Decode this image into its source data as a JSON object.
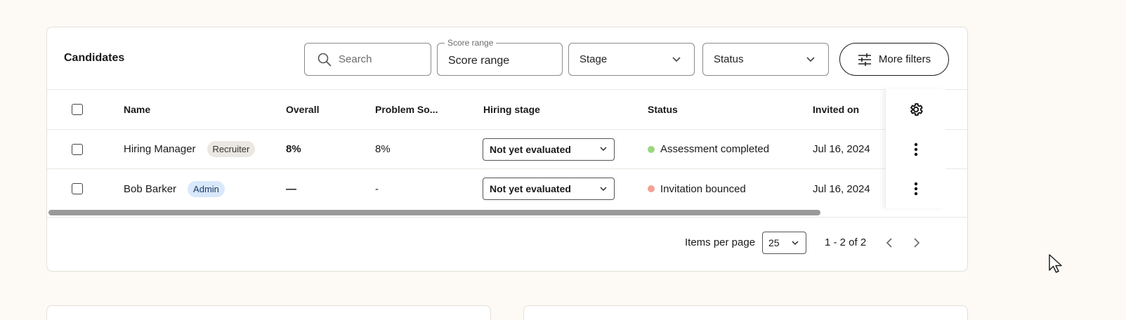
{
  "card": {
    "title": "Candidates",
    "search_placeholder": "Search",
    "score_range_legend": "Score range",
    "score_range_value": "Score range",
    "stage_label": "Stage",
    "status_label": "Status",
    "more_filters_label": "More filters"
  },
  "table": {
    "columns": [
      "Name",
      "Overall",
      "Problem So...",
      "Hiring stage",
      "Status",
      "Invited on"
    ],
    "rows": [
      {
        "name": "Hiring Manager",
        "role_tag": "Recruiter",
        "overall": "8%",
        "problem_solving": "8%",
        "hiring_stage": "Not yet evaluated",
        "status": "Assessment completed",
        "status_color": "#9bd77e",
        "invited_on": "Jul 16, 2024"
      },
      {
        "name": "Bob Barker",
        "role_tag": "Admin",
        "overall": "—",
        "problem_solving": "-",
        "hiring_stage": "Not yet evaluated",
        "status": "Invitation bounced",
        "status_color": "#f2a293",
        "invited_on": "Jul 16, 2024"
      }
    ]
  },
  "pager": {
    "items_per_page_label": "Items per page",
    "items_per_page_value": "25",
    "range_text": "1 - 2 of 2"
  },
  "icons": {
    "search": "search-icon",
    "filters": "sliders-icon",
    "settings": "gear-icon",
    "row_menu": "kebab-icon"
  }
}
